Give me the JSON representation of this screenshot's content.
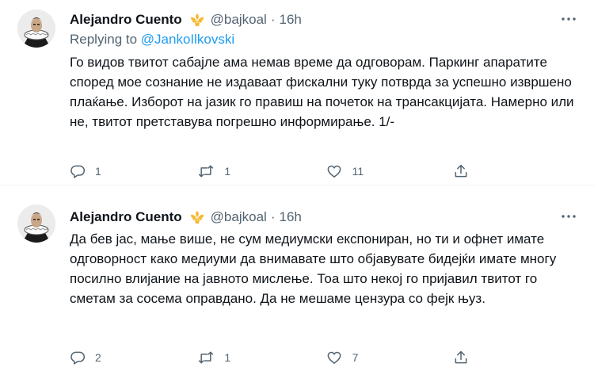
{
  "tweets": [
    {
      "author": {
        "name": "Alejandro Cuento",
        "handle": "@bajkoal",
        "separator": "·",
        "time": "16h"
      },
      "replying": {
        "prefix": "Replying to",
        "to": "@JankoIlkovski"
      },
      "text": "Го видов твитот сабајле ама немав време да одговорам. Паркинг апаратите според мое сознание не издаваат фискални туку потврда за успешно извршено плаќање. Изборот на јазик го правиш на почеток на трансакцијата. Намерно или не, твитот претставува погрешно информирање. 1/-",
      "counts": {
        "replies": "1",
        "retweets": "1",
        "likes": "11"
      }
    },
    {
      "author": {
        "name": "Alejandro Cuento",
        "handle": "@bajkoal",
        "separator": "·",
        "time": "16h"
      },
      "text": "Да бев јас, мање више, не сум медиумски експониран, но ти и офнет имате одговорност како медиуми да внимавате што објавувате бидејќи имате многу посилно влијание на јавното мислење. Тоа што некој го пријавил твитот го сметам за сосема оправдано. Да не мешаме цензура со фејк њуз.",
      "counts": {
        "replies": "2",
        "retweets": "1",
        "likes": "7"
      }
    }
  ],
  "icons": [
    "avatar-portrait",
    "badge-fleur-icon",
    "more-icon",
    "reply-icon",
    "retweet-icon",
    "like-icon",
    "share-icon"
  ],
  "colors": {
    "text": "#0f1419",
    "secondary": "#536471",
    "link": "#1d9bf0",
    "badge": "#f5b933"
  }
}
